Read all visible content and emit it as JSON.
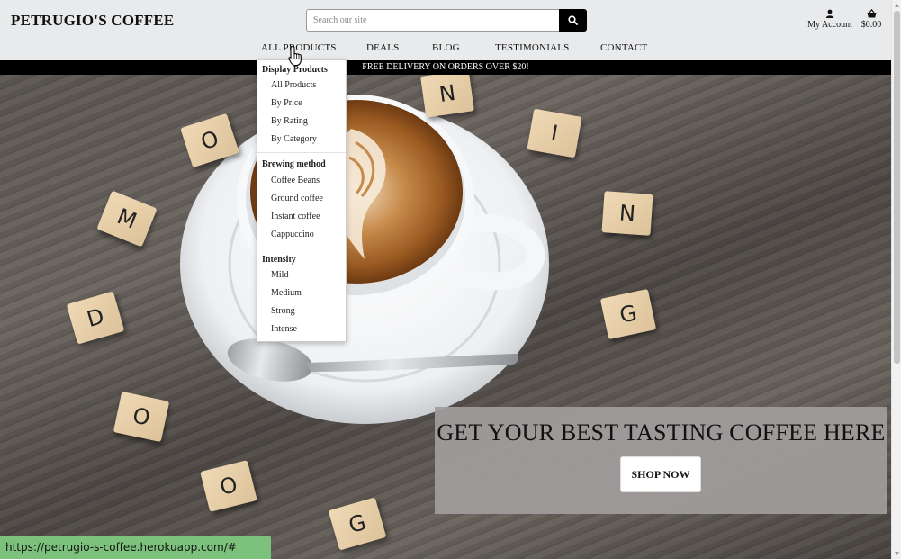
{
  "header": {
    "brand": "PETRUGIO'S COFFEE",
    "search_placeholder": "Search our site",
    "search_button_icon": "search-icon",
    "account_label": "My Account",
    "account_icon": "user-icon",
    "basket_total": "$0.00",
    "basket_icon": "shopping-basket-icon"
  },
  "nav": {
    "items": [
      "ALL PRODUCTS",
      "DEALS",
      "BLOG",
      "TESTIMONIALS",
      "CONTACT"
    ]
  },
  "dropdown": {
    "groups": [
      {
        "heading": "Display Products",
        "items": [
          "All Products",
          "By Price",
          "By Rating",
          "By Category"
        ]
      },
      {
        "heading": "Brewing method",
        "items": [
          "Coffee Beans",
          "Ground coffee",
          "Instant coffee",
          "Cappuccino"
        ]
      },
      {
        "heading": "Intensity",
        "items": [
          "Mild",
          "Medium",
          "Strong",
          "Intense"
        ]
      }
    ]
  },
  "banner": {
    "text": "FREE DELIVERY ON ORDERS OVER $20!"
  },
  "hero": {
    "title": "GET YOUR BEST TASTING COFFEE HERE",
    "button": "SHOP NOW",
    "tiles": [
      "N",
      "O",
      "I",
      "M",
      "N",
      "D",
      "G",
      "O",
      "O",
      "G"
    ]
  },
  "status": {
    "url": "https://petrugio-s-coffee.herokuapp.com/#"
  },
  "colors": {
    "header_bg": "#e9eaec",
    "banner_bg": "#000000",
    "status_bg": "#7cc27c",
    "cta_bg": "#a09d9c"
  }
}
